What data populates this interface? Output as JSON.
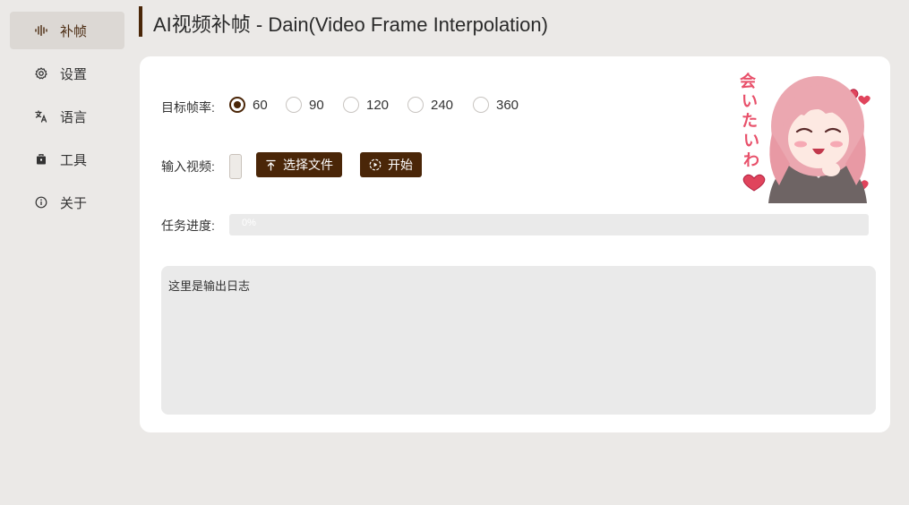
{
  "sidebar": {
    "items": [
      {
        "label": "补帧",
        "icon": "audio-wave-icon",
        "active": true
      },
      {
        "label": "设置",
        "icon": "gear-icon",
        "active": false
      },
      {
        "label": "语言",
        "icon": "translate-icon",
        "active": false
      },
      {
        "label": "工具",
        "icon": "toolbox-icon",
        "active": false
      },
      {
        "label": "关于",
        "icon": "info-icon",
        "active": false
      }
    ]
  },
  "header": {
    "title": "AI视频补帧 - Dain(Video Frame Interpolation)"
  },
  "form": {
    "fps_label": "目标帧率:",
    "fps_options": [
      "60",
      "90",
      "120",
      "240",
      "360"
    ],
    "fps_selected": "60",
    "video_label": "输入视频:",
    "select_file_label": "选择文件",
    "start_label": "开始",
    "progress_label": "任务进度:",
    "progress_text": "0%",
    "progress_value": 0,
    "log_text": "这里是输出日志"
  },
  "sticker": {
    "text": "会いたいわ"
  },
  "colors": {
    "accent": "#4a2608",
    "background": "#ebe9e7",
    "card": "#ffffff",
    "heart": "#e0445c"
  }
}
